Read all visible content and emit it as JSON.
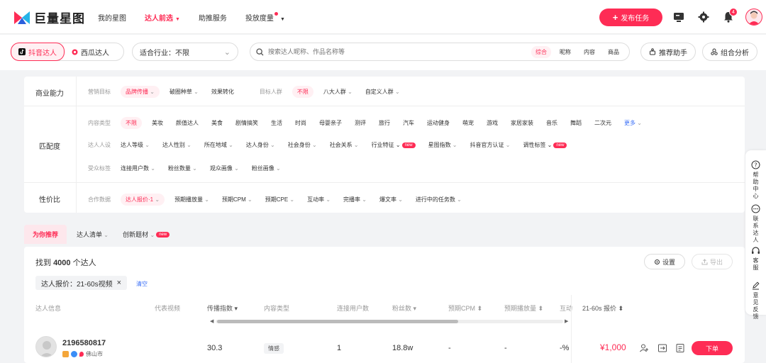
{
  "brand": {
    "name": "巨量星图",
    "accent": "#fe2c55"
  },
  "nav": {
    "items": [
      {
        "label": "我的星图",
        "active": false,
        "dropdown": false
      },
      {
        "label": "达人前选",
        "active": true,
        "dropdown": true
      },
      {
        "label": "助推服务",
        "active": false,
        "dropdown": false
      },
      {
        "label": "投放度量",
        "active": false,
        "dropdown": true,
        "dot": true
      }
    ],
    "publish_label": "发布任务",
    "notification_count": "4"
  },
  "search_bar": {
    "platforms": [
      "抖音达人",
      "西瓜达人"
    ],
    "industry": "适合行业：不限",
    "search_placeholder": "搜索达人昵称、作品名称等",
    "search_options": [
      "综合",
      "昵称",
      "内容",
      "商品"
    ],
    "assist_label": "推荐助手",
    "combo_label": "组合分析"
  },
  "filters": {
    "sections": [
      "商业能力",
      "匹配度",
      "性价比"
    ],
    "marketing_goal_label": "营销目标",
    "marketing_goals": [
      "品牌传播",
      "破圈种草",
      "效果转化"
    ],
    "target_crowd_label": "目标人群",
    "target_crowd": [
      "不限",
      "八大人群",
      "自定义人群"
    ],
    "content_type_label": "内容类型",
    "content_types": [
      "不限",
      "美妆",
      "颜值达人",
      "美食",
      "剧情搞笑",
      "生活",
      "时尚",
      "母婴亲子",
      "测评",
      "旅行",
      "汽车",
      "运动健身",
      "萌宠",
      "游戏",
      "家居家装",
      "音乐",
      "舞蹈",
      "二次元"
    ],
    "more_label": "更多",
    "persona_label": "达人人设",
    "persona": [
      "达人等级",
      "达人性别",
      "所在地域",
      "达人身份",
      "社会身份",
      "社会关系",
      "行业特征",
      "星图指数",
      "抖音官方认证",
      "调性标签"
    ],
    "audience_label": "受众标签",
    "audience": [
      "连接用户数",
      "粉丝数量",
      "观众画像",
      "粉丝画像"
    ],
    "coop_label": "合作数据",
    "coop": [
      "达人报价·1",
      "预期播放量",
      "预期CPM",
      "预期CPE",
      "互动率",
      "完播率",
      "爆文率",
      "进行中的任务数"
    ],
    "new_tag": "new"
  },
  "recommend": {
    "active": "为你推荐",
    "items": [
      "达人清单",
      "创新题材"
    ]
  },
  "results": {
    "found_prefix": "找到",
    "found_count": "4000",
    "found_suffix": "个达人",
    "settings_label": "设置",
    "export_label": "导出",
    "chip_label": "达人报价：21-60s视频",
    "clear_label": "清空",
    "columns": [
      "达人信息",
      "代表视频",
      "传播指数",
      "内容类型",
      "连接用户数",
      "粉丝数",
      "预期CPM",
      "预期播放量",
      "互动",
      "21-60s 报价"
    ],
    "rows": [
      {
        "uid": "2196580817",
        "city": "佛山市",
        "spread_index": "30.3",
        "content_type": "情感",
        "connections": "1",
        "fans": "18.8w",
        "cpm": "-",
        "plays": "-",
        "interact": "-%",
        "price": "¥1,000",
        "order_label": "下单"
      }
    ]
  },
  "float_panel": [
    "帮助中心",
    "联系达人",
    "客服",
    "意见反馈"
  ]
}
